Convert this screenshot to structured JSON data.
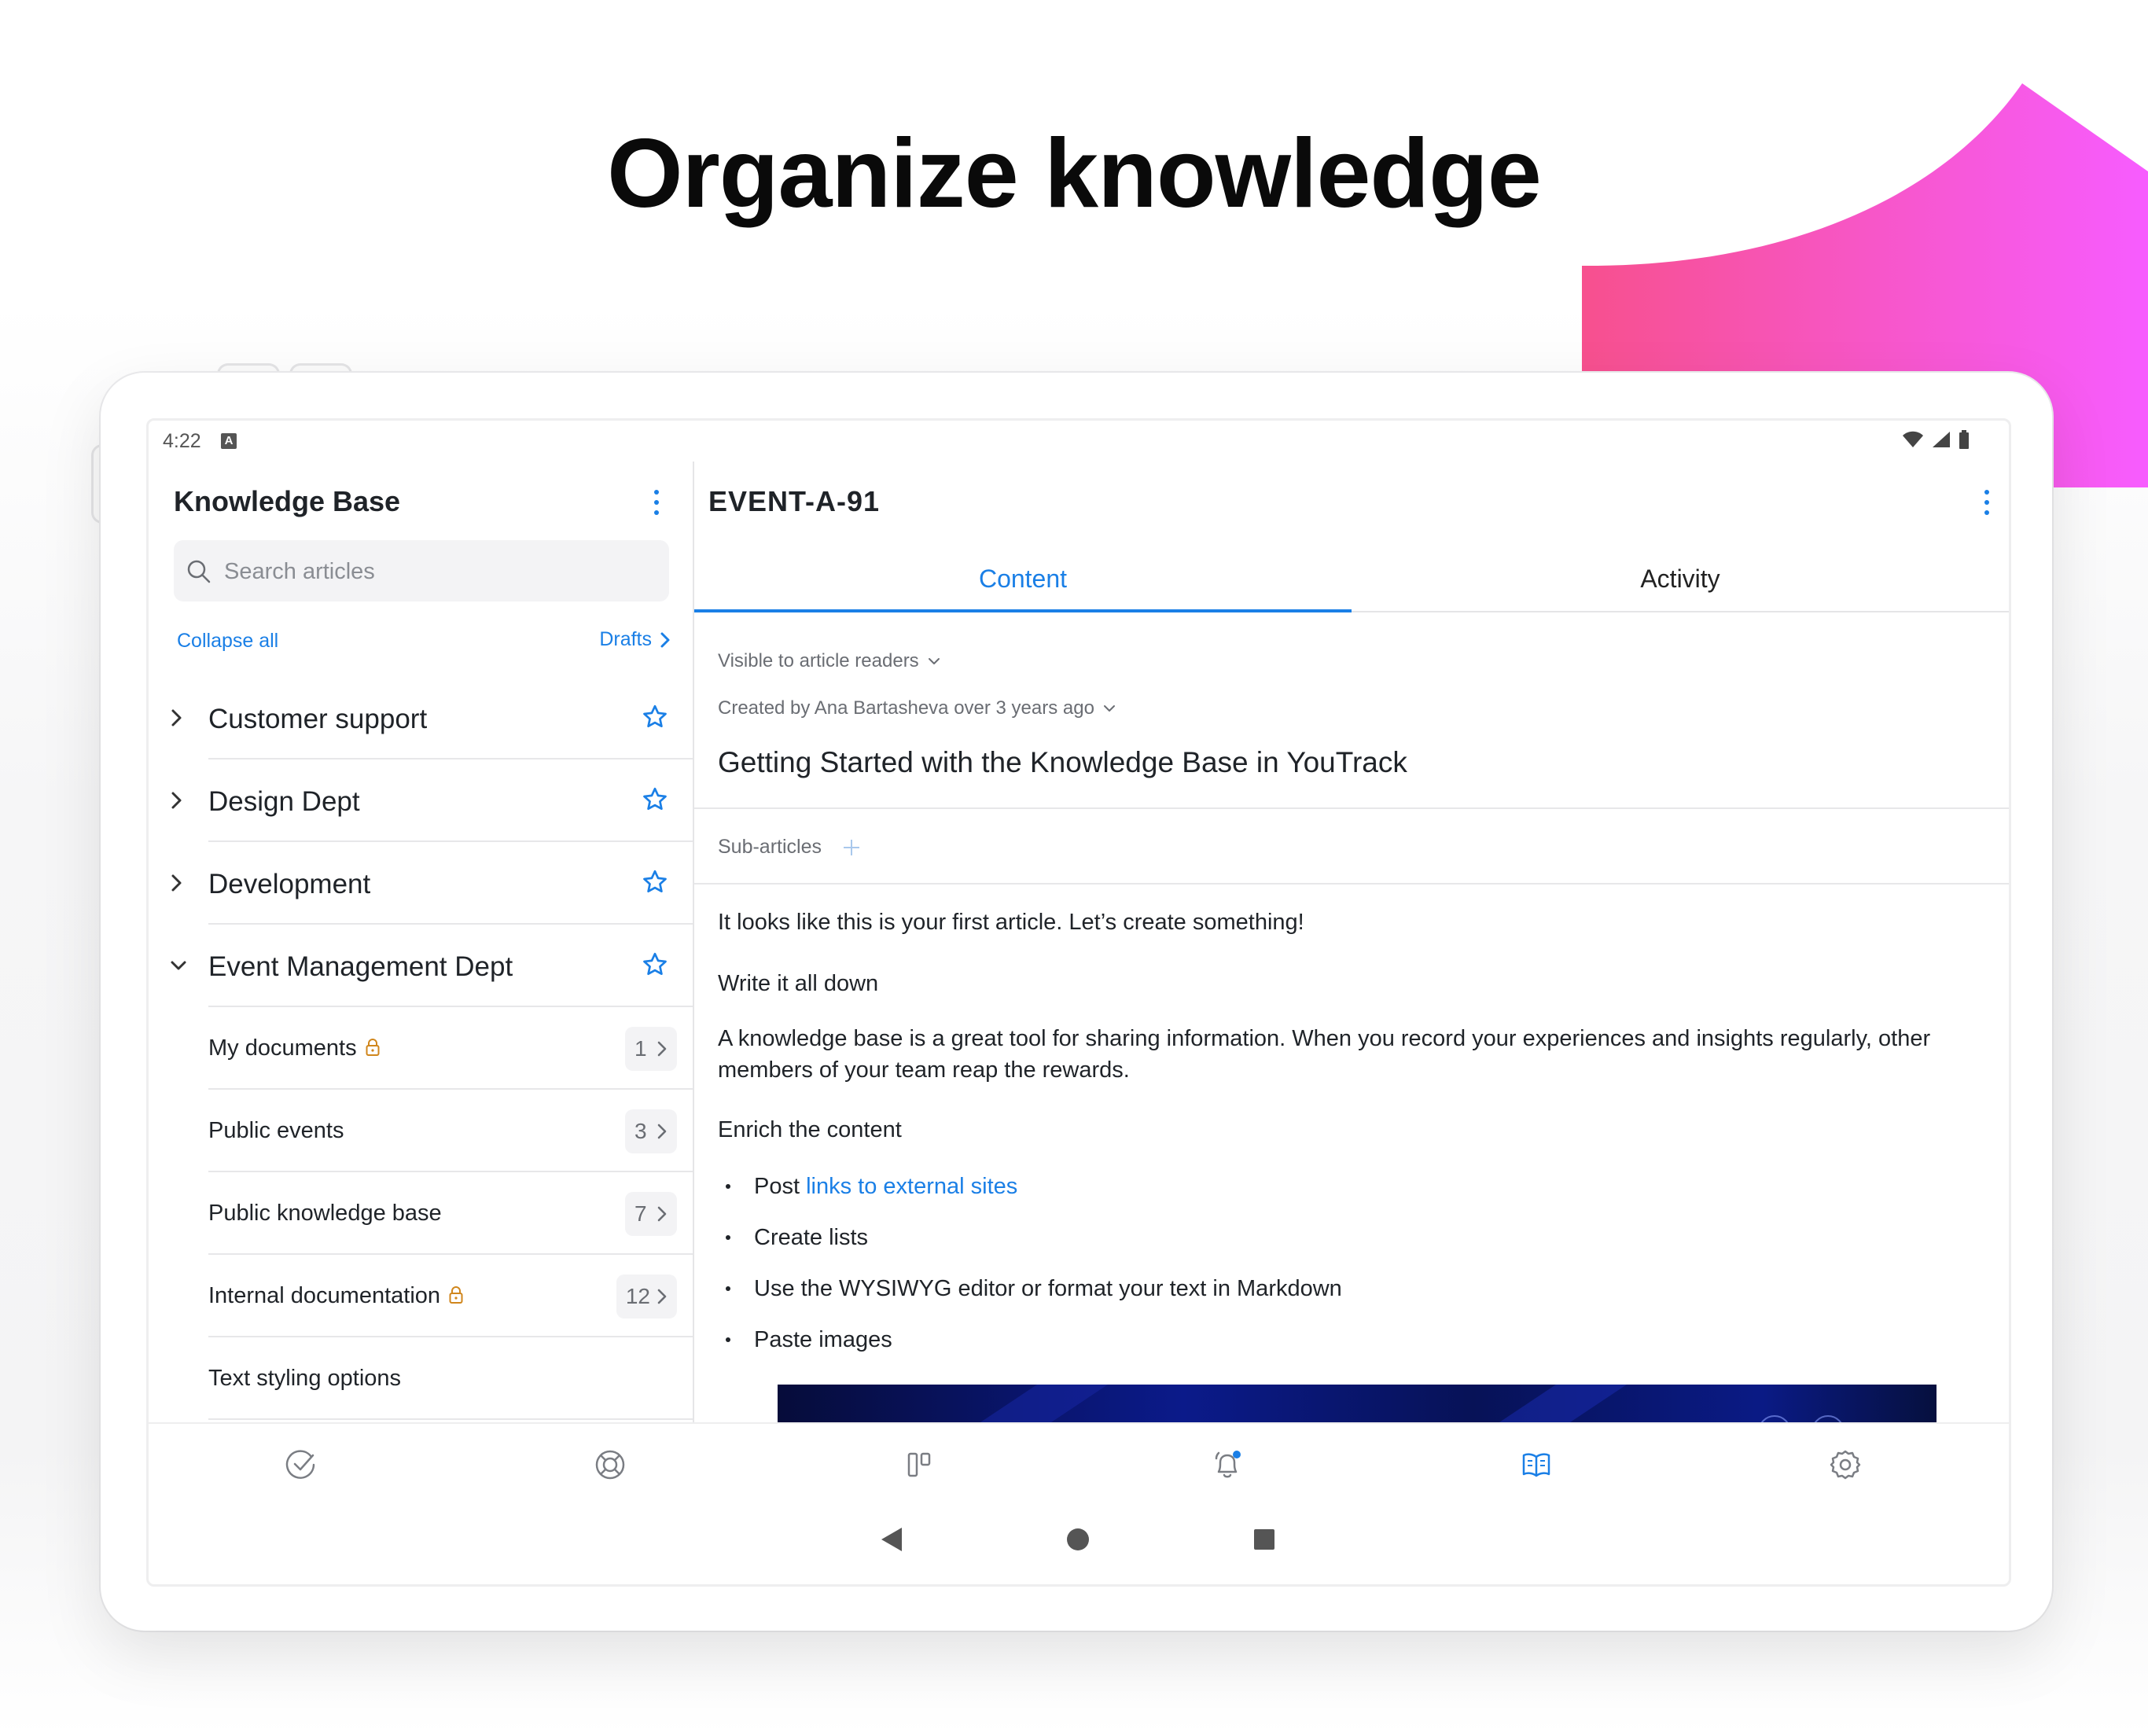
{
  "headline": "Organize knowledge",
  "colors": {
    "accent": "#1a7fe6",
    "blob_start": "#f7508e",
    "blob_end": "#f75cff",
    "lock": "#d0861c"
  },
  "statusbar": {
    "time": "4:22",
    "notification_badge": "A",
    "icons": [
      "wifi-icon",
      "signal-icon",
      "battery-icon"
    ]
  },
  "left": {
    "title": "Knowledge Base",
    "search_placeholder": "Search articles",
    "collapse_all": "Collapse all",
    "drafts": "Drafts",
    "projects": [
      {
        "label": "Customer support",
        "expanded": false,
        "starred": false
      },
      {
        "label": "Design Dept",
        "expanded": false,
        "starred": false
      },
      {
        "label": "Development",
        "expanded": false,
        "starred": false
      },
      {
        "label": "Event Management Dept",
        "expanded": true,
        "starred": false
      }
    ],
    "articles": [
      {
        "label": "My documents",
        "locked": true,
        "count": "1"
      },
      {
        "label": "Public events",
        "locked": false,
        "count": "3"
      },
      {
        "label": "Public knowledge base",
        "locked": false,
        "count": "7"
      },
      {
        "label": "Internal documentation",
        "locked": true,
        "count": "12"
      },
      {
        "label": "Text styling options",
        "locked": false,
        "count": ""
      }
    ]
  },
  "right": {
    "issue_id": "EVENT-A-91",
    "tabs": [
      "Content",
      "Activity"
    ],
    "active_tab": "Content",
    "visibility": "Visible to article readers",
    "created": "Created by Ana Bartasheva over 3 years ago",
    "article_title": "Getting Started with the Knowledge Base in YouTrack",
    "sub_articles": "Sub-articles",
    "paragraphs": {
      "p1": "It looks like this is your first article. Let’s create something!",
      "p2": "Write it all down",
      "p3_line1": "A knowledge base is a great tool for sharing information. When you record your experiences and insights regularly, other",
      "p3_line2": "members of your team reap the rewards.",
      "p4": "Enrich the content"
    },
    "bullets": {
      "b1_prefix": "Post ",
      "b1_link": "links to external sites",
      "b2": "Create lists",
      "b3": "Use the WYSIWYG editor or format your text in Markdown",
      "b4": "Paste images"
    }
  },
  "bottom_nav": [
    "checkmark-icon",
    "lifebuoy-icon",
    "board-icon",
    "bell-icon",
    "book-icon",
    "gear-icon"
  ],
  "bottom_nav_active": "book-icon"
}
